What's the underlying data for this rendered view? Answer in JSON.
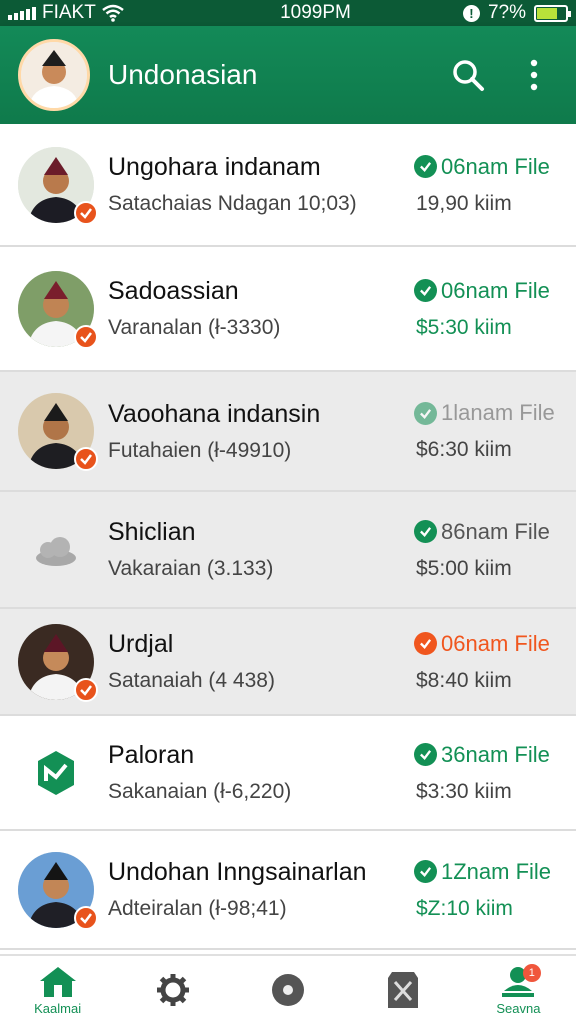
{
  "status_bar": {
    "carrier": "FIAKT",
    "time": "1099PM",
    "battery": "7?%"
  },
  "app_bar": {
    "title": "Undonasian",
    "icons": [
      "search-icon",
      "more-vert-icon"
    ]
  },
  "contacts": [
    {
      "name": "Ungohara indanam",
      "subtitle": "Satachaias Ndagan 10;03)",
      "status": "06nam File",
      "price": "19,90 kiim",
      "status_style": "green",
      "price_style": "gray"
    },
    {
      "name": "Sadoassian",
      "subtitle": "Varanalan (ł-3330)",
      "status": "06nam File",
      "price": "$5:30 kiim",
      "status_style": "green",
      "price_style": "green"
    },
    {
      "name": "Vaoohana indansin",
      "subtitle": "Futahaien (ł-49910)",
      "status": "1lanam File",
      "price": "$6:30 kiim",
      "status_style": "faded",
      "price_style": "gray"
    },
    {
      "name": "Shiclian",
      "subtitle": "Vakaraian (3.133)",
      "status": "86nam File",
      "price": "$5:00 kiim",
      "status_style": "gray",
      "price_style": "gray"
    },
    {
      "name": "Urdjal",
      "subtitle": "Satanaiah (4 438)",
      "status": "06nam File",
      "price": "$8:40 kiim",
      "status_style": "orange",
      "price_style": "gray"
    },
    {
      "name": "Paloran",
      "subtitle": "Sakanaian (ł-6,220)",
      "status": "36nam File",
      "price": "$3:30 kiim",
      "status_style": "green",
      "price_style": "gray"
    },
    {
      "name": "Undohan Inngsainarlan",
      "subtitle": "Adteiralan (ł-98;41)",
      "status": "1Znam File",
      "price": "$Z:10 kiim",
      "status_style": "green",
      "price_style": "green"
    }
  ],
  "bottom_nav": {
    "home_label": "Kaalmai",
    "profile_label": "Seavna",
    "profile_badge": "1",
    "icons": [
      "home-icon",
      "settings-icon",
      "disc-icon",
      "document-icon",
      "profile-icon"
    ]
  },
  "colors": {
    "primary": "#139055",
    "status_bar": "#0c5a36",
    "accent_orange": "#f0561e"
  }
}
